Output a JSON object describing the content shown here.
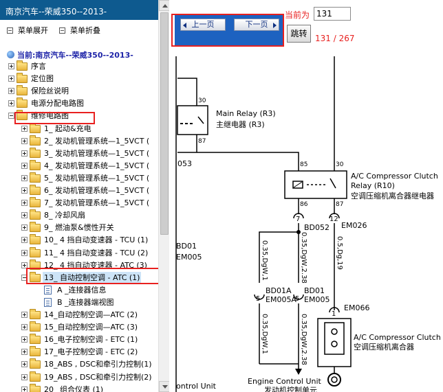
{
  "left_panel": {
    "title": "南京汽车--荣威350--2013-",
    "menu": {
      "expand": "菜单展开",
      "collapse": "菜单折叠"
    },
    "current_label": "当前:南京汽车--荣威350--2013-",
    "tree": [
      {
        "label": "序言",
        "kind": "folder",
        "toggle": "plus",
        "level": 0
      },
      {
        "label": "定位图",
        "kind": "folder",
        "toggle": "plus",
        "level": 0
      },
      {
        "label": "保险丝说明",
        "kind": "folder",
        "toggle": "plus",
        "level": 0
      },
      {
        "label": "电源分配电路图",
        "kind": "folder",
        "toggle": "plus",
        "level": 0
      },
      {
        "label": "维修电路图",
        "kind": "folder",
        "toggle": "minus",
        "level": 0
      },
      {
        "label": "1_ 起动&充电",
        "kind": "folder",
        "toggle": "plus",
        "level": 1
      },
      {
        "label": "2_ 发动机管理系统—1_5VCT (",
        "kind": "folder",
        "toggle": "plus",
        "level": 1
      },
      {
        "label": "3_ 发动机管理系统—1_5VCT (",
        "kind": "folder",
        "toggle": "plus",
        "level": 1
      },
      {
        "label": "4_ 发动机管理系统—1_5VCT (",
        "kind": "folder",
        "toggle": "plus",
        "level": 1
      },
      {
        "label": "5_ 发动机管理系统—1_5VCT (",
        "kind": "folder",
        "toggle": "plus",
        "level": 1
      },
      {
        "label": "6_ 发动机管理系统—1_5VCT (",
        "kind": "folder",
        "toggle": "plus",
        "level": 1
      },
      {
        "label": "7_ 发动机管理系统—1_5VCT (",
        "kind": "folder",
        "toggle": "plus",
        "level": 1
      },
      {
        "label": "8_ 冷却风扇",
        "kind": "folder",
        "toggle": "plus",
        "level": 1
      },
      {
        "label": "9_ 燃油泵&惯性开关",
        "kind": "folder",
        "toggle": "plus",
        "level": 1
      },
      {
        "label": "10_ 4 挡自动变速器 - TCU (1)",
        "kind": "folder",
        "toggle": "plus",
        "level": 1
      },
      {
        "label": "11_ 4 挡自动变速器 - TCU (2)",
        "kind": "folder",
        "toggle": "plus",
        "level": 1
      },
      {
        "label": "12_ 4 挡自动变速器 - ATC (3)",
        "kind": "folder",
        "toggle": "plus",
        "level": 1
      },
      {
        "label": "13_ 自动控制空调 - ATC (1)",
        "kind": "folder",
        "toggle": "minus",
        "level": 1,
        "selected": true
      },
      {
        "label": "A _连接器信息",
        "kind": "doc",
        "toggle": "none",
        "level": 2
      },
      {
        "label": "B _连接器端视图",
        "kind": "doc",
        "toggle": "none",
        "level": 2
      },
      {
        "label": "14_自动控制空调—ATC (2)",
        "kind": "folder",
        "toggle": "plus",
        "level": 1
      },
      {
        "label": "15_自动控制空调—ATC (3)",
        "kind": "folder",
        "toggle": "plus",
        "level": 1
      },
      {
        "label": "16_电子控制空调 - ETC (1)",
        "kind": "folder",
        "toggle": "plus",
        "level": 1
      },
      {
        "label": "17_电子控制空调 - ETC (2)",
        "kind": "folder",
        "toggle": "plus",
        "level": 1
      },
      {
        "label": "18_ABS , DSC和牵引力控制(1)",
        "kind": "folder",
        "toggle": "plus",
        "level": 1
      },
      {
        "label": "19_ABS , DSC和牵引力控制(2)",
        "kind": "folder",
        "toggle": "plus",
        "level": 1
      },
      {
        "label": "20_ 组合仪表 (1)",
        "kind": "folder",
        "toggle": "plus",
        "level": 1
      }
    ]
  },
  "toolbar": {
    "prev_label": "上一页",
    "next_label": "下一页",
    "current_page_label": "当前为",
    "page_value": "131",
    "jump_label": "跳转",
    "page_count": "131 / 267"
  },
  "diagram": {
    "main_relay_en": "Main Relay (R3)",
    "main_relay_cn": "主继电器 (R3)",
    "pin_30_a": "30",
    "pin_87_a": "87",
    "label_053": "053",
    "ac_relay_en_1": "A/C Compressor Clutch",
    "ac_relay_en_2": "Relay (R10)",
    "ac_relay_cn": "空调压缩机离合器继电器",
    "pin_85": "85",
    "pin_30_b": "30",
    "pin_86": "86",
    "pin_87_b": "87",
    "conn_7": "7",
    "conn_bd052": "BD052",
    "conn_12": "12",
    "conn_em026": "EM026",
    "bd01": "BD01",
    "em005_left": "EM005",
    "wire_035_dgw1_a": "0.35,DgW,1",
    "wire_035_dgw238_a": "0.35,DgW,2.38",
    "wire_05_dg19": "0.5,Dg,19",
    "conn_bd01a": "BD01A",
    "conn_em005a": "EM005A",
    "conn_bd01_b": "BD01",
    "conn_em005_b": "EM005",
    "pin_5a": "5",
    "pin_5b": "5",
    "conn_1": "1",
    "conn_em066": "EM066",
    "wire_035_dgw1_b": "0.35,DgW,1",
    "wire_035_dgw238_b": "0.35,DgW,2.38",
    "ac_clutch_en": "A/C Compressor Clutch",
    "ac_clutch_cn": "空调压缩机离合器",
    "control_unit_left": "ontrol Unit",
    "ecu_en": "Engine Control Unit",
    "ecu_cn": "发动机控制单元"
  }
}
